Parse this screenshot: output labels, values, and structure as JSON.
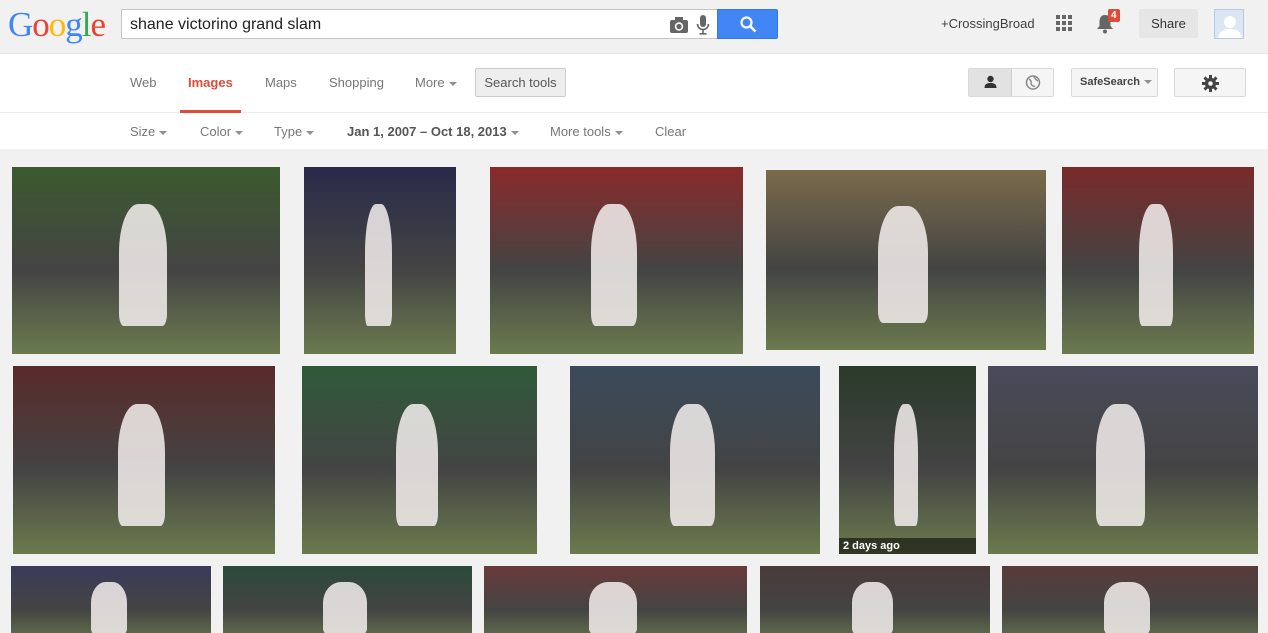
{
  "header": {
    "logo_letters": [
      {
        "ch": "G",
        "color": "#4285f4"
      },
      {
        "ch": "o",
        "color": "#ea4335"
      },
      {
        "ch": "o",
        "color": "#fbbc05"
      },
      {
        "ch": "g",
        "color": "#4285f4"
      },
      {
        "ch": "l",
        "color": "#34a853"
      },
      {
        "ch": "e",
        "color": "#ea4335"
      }
    ],
    "search_query": "shane victorino grand slam",
    "camera_icon": "camera-icon",
    "mic_icon": "microphone-icon",
    "search_icon": "magnifier-icon",
    "plus_link": "+CrossingBroad",
    "apps_icon": "apps-grid-icon",
    "notification_count": "4",
    "share_label": "Share"
  },
  "nav": {
    "tabs": [
      {
        "label": "Web",
        "active": false
      },
      {
        "label": "Images",
        "active": true
      },
      {
        "label": "Maps",
        "active": false
      },
      {
        "label": "Shopping",
        "active": false
      },
      {
        "label": "More",
        "active": false
      }
    ],
    "search_tools_label": "Search tools",
    "safesearch_label": "SafeSearch",
    "accent_color": "#dd4b39"
  },
  "tools": {
    "size": "Size",
    "color": "Color",
    "type": "Type",
    "date_range": "Jan 1, 2007 – Oct 18, 2013",
    "more_tools": "More tools",
    "clear": "Clear"
  },
  "results": {
    "thumbs": [
      {
        "caption": "",
        "bg": "#3b5a2e"
      },
      {
        "caption": "",
        "bg": "#2a2a4a"
      },
      {
        "caption": "",
        "bg": "#8a2a2a"
      },
      {
        "caption": "",
        "bg": "#7a6a4a"
      },
      {
        "caption": "",
        "bg": "#7a2a2a"
      },
      {
        "caption": "",
        "bg": "#5a2a2a"
      },
      {
        "caption": "",
        "bg": "#2f5a3a"
      },
      {
        "caption": "",
        "bg": "#3a4a5a"
      },
      {
        "caption": "2 days ago",
        "bg": "#2a3a2a"
      },
      {
        "caption": "",
        "bg": "#4a4a5a"
      },
      {
        "caption": "",
        "bg": "#3a3a5a"
      },
      {
        "caption": "",
        "bg": "#2a4a3a"
      },
      {
        "caption": "",
        "bg": "#6a3a3a"
      },
      {
        "caption": "",
        "bg": "#4a3a3a"
      },
      {
        "caption": "",
        "bg": "#5a3a3a"
      }
    ]
  }
}
